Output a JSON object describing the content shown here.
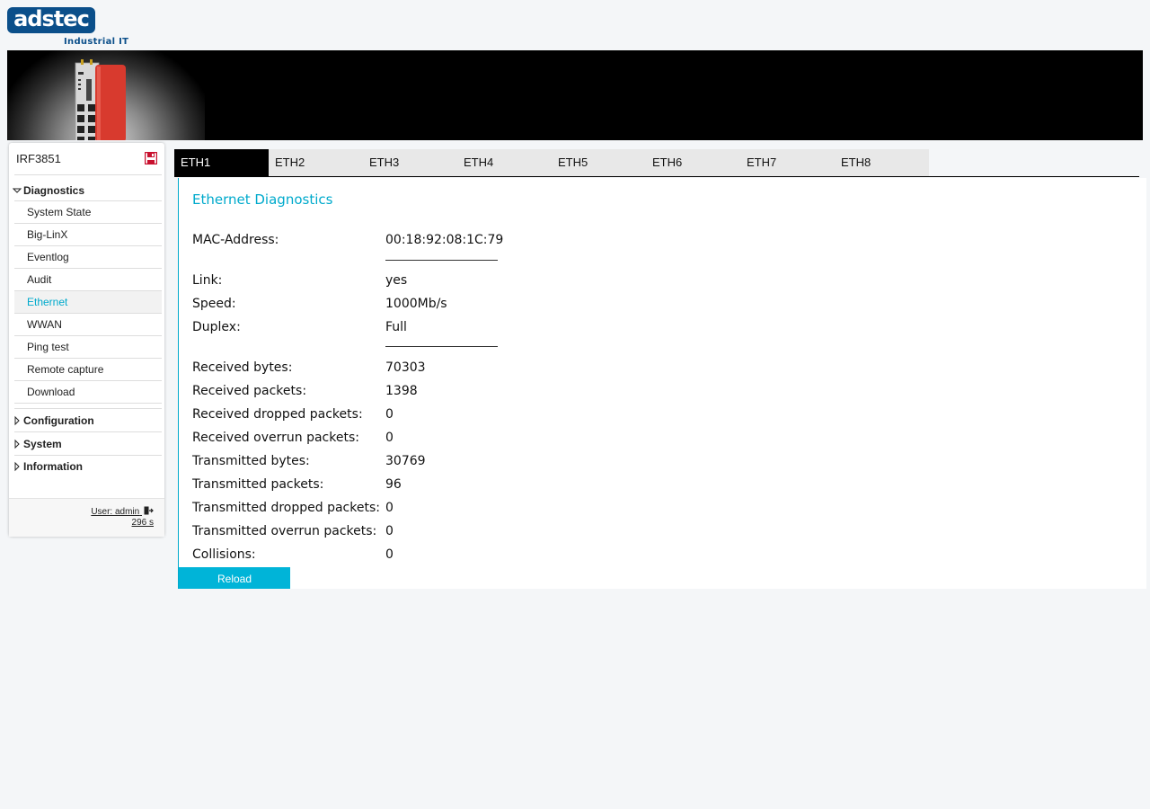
{
  "logo": {
    "brand": "adstec",
    "tagline": "Industrial IT"
  },
  "sidebar": {
    "device_name": "IRF3851",
    "groups": [
      {
        "label": "Diagnostics",
        "expanded": true,
        "items": [
          "System State",
          "Big-LinX",
          "Eventlog",
          "Audit",
          "Ethernet",
          "WWAN",
          "Ping test",
          "Remote capture",
          "Download"
        ],
        "active_item": "Ethernet"
      },
      {
        "label": "Configuration",
        "expanded": false
      },
      {
        "label": "System",
        "expanded": false
      },
      {
        "label": "Information",
        "expanded": false
      }
    ],
    "user_label": "User: admin",
    "session_timer": "296 s"
  },
  "tabs": {
    "items": [
      "ETH1",
      "ETH2",
      "ETH3",
      "ETH4",
      "ETH5",
      "ETH6",
      "ETH7",
      "ETH8"
    ],
    "active": "ETH1"
  },
  "main": {
    "title": "Ethernet Diagnostics",
    "rows": [
      {
        "label": "MAC-Address:",
        "value": "00:18:92:08:1C:79"
      },
      {
        "label": "Link:",
        "value": "yes"
      },
      {
        "label": "Speed:",
        "value": "1000Mb/s"
      },
      {
        "label": "Duplex:",
        "value": "Full"
      },
      {
        "label": "Received bytes:",
        "value": "70303"
      },
      {
        "label": "Received packets:",
        "value": "1398"
      },
      {
        "label": "Received dropped packets:",
        "value": "0"
      },
      {
        "label": "Received overrun packets:",
        "value": "0"
      },
      {
        "label": "Transmitted bytes:",
        "value": "30769"
      },
      {
        "label": "Transmitted packets:",
        "value": "96"
      },
      {
        "label": "Transmitted dropped packets:",
        "value": "0"
      },
      {
        "label": "Transmitted overrun packets:",
        "value": "0"
      },
      {
        "label": "Collisions:",
        "value": "0"
      }
    ],
    "reload_label": "Reload"
  },
  "colors": {
    "accent": "#00aacc",
    "button": "#00b4d8",
    "brand": "#0b4f8a",
    "save_icon": "#c8102e"
  }
}
